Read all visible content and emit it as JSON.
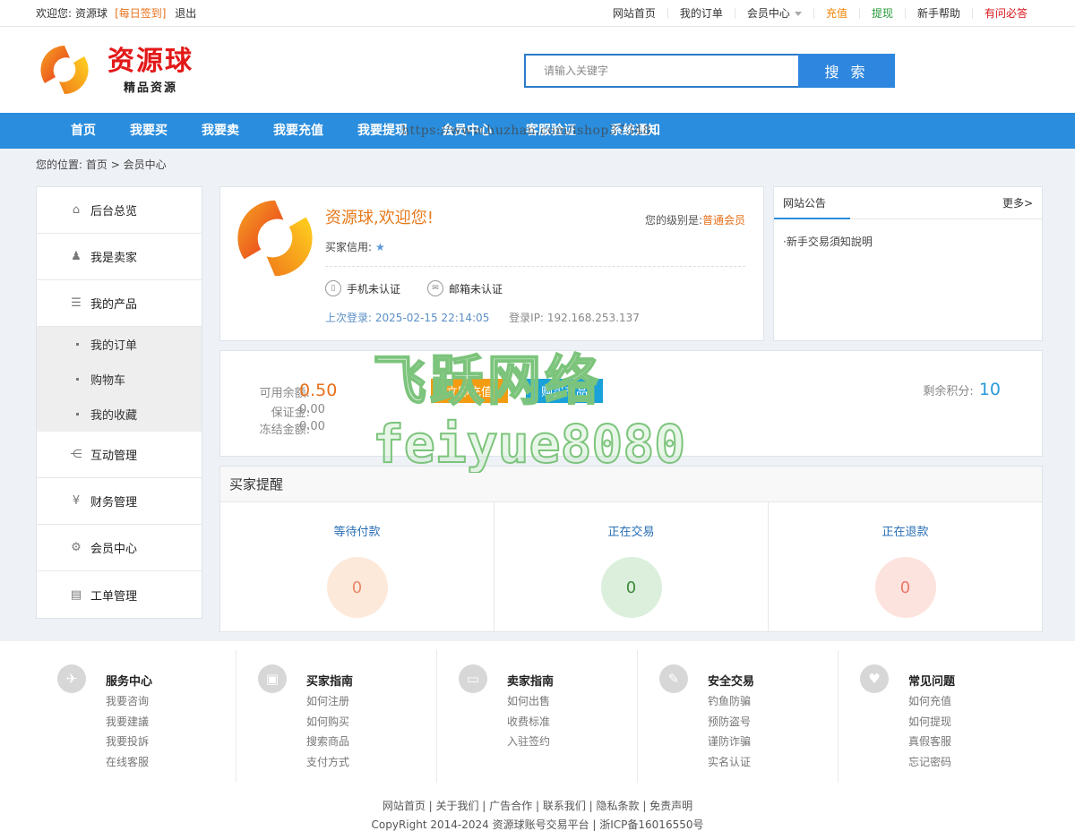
{
  "topbar": {
    "welcome_prefix": "欢迎您:",
    "username": "资源球",
    "checkin": "[每日签到]",
    "logout": "退出",
    "links": [
      {
        "label": "网站首页",
        "color": "#333333"
      },
      {
        "label": "我的订单",
        "color": "#333333"
      },
      {
        "label": "会员中心",
        "color": "#333333"
      },
      {
        "label": "充值",
        "color": "#f08300"
      },
      {
        "label": "提现",
        "color": "#2b9a3d"
      },
      {
        "label": "新手帮助",
        "color": "#333333"
      },
      {
        "label": "有问必答",
        "color": "#d9161c"
      }
    ]
  },
  "header": {
    "logo_main": "资源球",
    "logo_sub": "精品资源",
    "search_placeholder": "请输入关键字",
    "search_button": "搜 索"
  },
  "nav": {
    "items": [
      "首页",
      "我要买",
      "我要卖",
      "我要充值",
      "我要提现",
      "会员中心",
      "客服验证",
      "系统通知"
    ],
    "watermark_url": "https://www.huzhan.com/ishop37348",
    "color": "#2a8ddd"
  },
  "breadcrumb": {
    "prefix": "您的位置:",
    "home": "首页",
    "sep": ">",
    "current": "会员中心"
  },
  "sidebar": {
    "items": [
      {
        "label": "后台总览",
        "icon": "home-icon"
      },
      {
        "label": "我是卖家",
        "icon": "user-icon"
      },
      {
        "label": "我的产品",
        "icon": "list-icon"
      }
    ],
    "sub_items": [
      "我的订单",
      "购物车",
      "我的收藏"
    ],
    "items_after": [
      {
        "label": "互动管理",
        "icon": "share-icon"
      },
      {
        "label": "财务管理",
        "icon": "yen-icon"
      },
      {
        "label": "会员中心",
        "icon": "gear-icon"
      },
      {
        "label": "工单管理",
        "icon": "clipboard-icon"
      }
    ]
  },
  "profile": {
    "welcome": "资源球,欢迎您!",
    "level_label": "您的级别是:",
    "level_value": "普通会员",
    "credit_label": "买家信用:",
    "phone_status": "手机未认证",
    "email_status": "邮箱未认证",
    "last_login_label": "上次登录:",
    "last_login_time": "2025-02-15 22:14:05",
    "login_ip_label": "登录IP:",
    "login_ip": "192.168.253.137"
  },
  "notice": {
    "tab": "网站公告",
    "more": "更多>",
    "items": [
      "·新手交易須知說明"
    ]
  },
  "balance": {
    "available_label": "可用余额:",
    "available": "0.50",
    "deposit_label": "保证金:",
    "deposit": "0.00",
    "frozen_label": "冻结金额:",
    "frozen": "0.00",
    "recharge_button": "立即充值",
    "buy_button": "购买产品",
    "points_label": "剩余积分:",
    "points": "10"
  },
  "watermark": {
    "line1": "飞跃网络",
    "line2": "feiyue8080"
  },
  "reminder": {
    "title": "买家提醒",
    "cols": [
      {
        "label": "等待付款",
        "value": "0",
        "bg": "#fde9da",
        "fg": "#e88a6a"
      },
      {
        "label": "正在交易",
        "value": "0",
        "bg": "#dcefdc",
        "fg": "#3c8a3c"
      },
      {
        "label": "正在退款",
        "value": "0",
        "bg": "#fde3dd",
        "fg": "#e87a6a"
      }
    ]
  },
  "footer": {
    "cols": [
      {
        "title": "服务中心",
        "icon": "compass-icon",
        "links": [
          "我要咨询",
          "我要建議",
          "我要投訴",
          "在线客服"
        ]
      },
      {
        "title": "买家指南",
        "icon": "bus-icon",
        "links": [
          "如何注册",
          "如何购买",
          "搜索商品",
          "支付方式"
        ]
      },
      {
        "title": "卖家指南",
        "icon": "wallet-icon",
        "links": [
          "如何出售",
          "收费标准",
          "入驻签约"
        ]
      },
      {
        "title": "安全交易",
        "icon": "wrench-icon",
        "links": [
          "钓鱼防骗",
          "预防盗号",
          "谨防诈骗",
          "实名认证"
        ]
      },
      {
        "title": "常见问题",
        "icon": "heart-icon",
        "links": [
          "如何充值",
          "如何提现",
          "真假客服",
          "忘记密码"
        ]
      }
    ],
    "bottom_links": "网站首页 | 关于我们 | 广告合作 | 联系我们 | 隐私条款 | 免责声明",
    "copyright": "CopyRight 2014-2024 资源球账号交易平台 | 浙ICP备16016550号"
  }
}
